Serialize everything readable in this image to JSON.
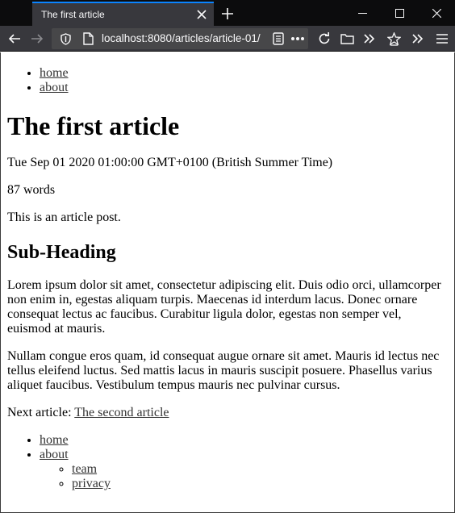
{
  "browser": {
    "tab_title": "The first article",
    "url": "localhost:8080/articles/article-01/",
    "icons": [
      "back-icon",
      "forward-icon",
      "shield-icon",
      "page-icon",
      "reader-mode-icon",
      "more-icon",
      "reload-icon",
      "folder-icon",
      "overflow-icon",
      "bookmark-star-icon",
      "menu-icon"
    ]
  },
  "header_nav": [
    {
      "label": "home"
    },
    {
      "label": "about"
    }
  ],
  "article": {
    "title": "The first article",
    "date": "Tue Sep 01 2020 01:00:00 GMT+0100 (British Summer Time)",
    "word_count": "87 words",
    "intro": "This is an article post.",
    "subheading": "Sub-Heading",
    "paragraphs": [
      "Lorem ipsum dolor sit amet, consectetur adipiscing elit. Duis odio orci, ullamcorper non enim in, egestas aliquam turpis. Maecenas id interdum lacus. Donec ornare consequat lectus ac faucibus. Curabitur ligula dolor, egestas non semper vel, euismod at mauris.",
      "Nullam congue eros quam, id consequat augue ornare sit amet. Mauris id lectus nec tellus eleifend luctus. Sed mattis lacus in mauris suscipit posuere. Phasellus varius aliquet faucibus. Vestibulum tempus mauris nec pulvinar cursus."
    ],
    "next_label": "Next article:",
    "next_link": "The second article"
  },
  "footer_nav": {
    "home": "home",
    "about": "about",
    "about_children": [
      "team",
      "privacy"
    ]
  }
}
